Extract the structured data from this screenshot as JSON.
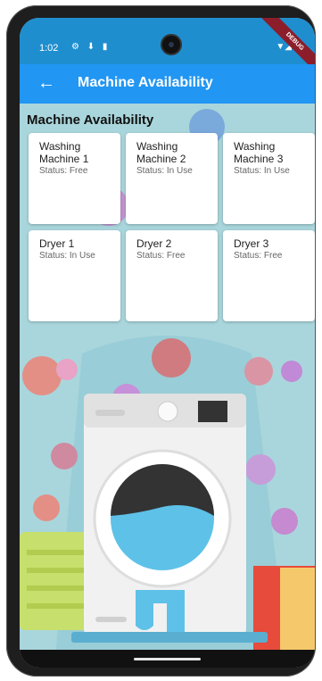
{
  "status_bar": {
    "time": "1:02",
    "icons": "⚙ ⬇ ▮",
    "signal_icons": "▼◢",
    "debug_label": "DEBUG"
  },
  "app_bar": {
    "back_icon": "←",
    "title": "Machine Availability"
  },
  "section": {
    "title": "Machine Availability"
  },
  "machines": [
    {
      "name": "Washing Machine 1",
      "status": "Status: Free"
    },
    {
      "name": "Washing Machine 2",
      "status": "Status: In Use"
    },
    {
      "name": "Washing Machine 3",
      "status": "Status: In Use"
    },
    {
      "name": "Dryer 1",
      "status": "Status: In Use"
    },
    {
      "name": "Dryer 2",
      "status": "Status: Free"
    },
    {
      "name": "Dryer 3",
      "status": "Status: Free"
    }
  ],
  "colors": {
    "app_bar": "#2196f3",
    "status_bar": "#1f8ecf",
    "background": "#a9d6dc",
    "debug_ribbon": "#8c1d2b"
  }
}
